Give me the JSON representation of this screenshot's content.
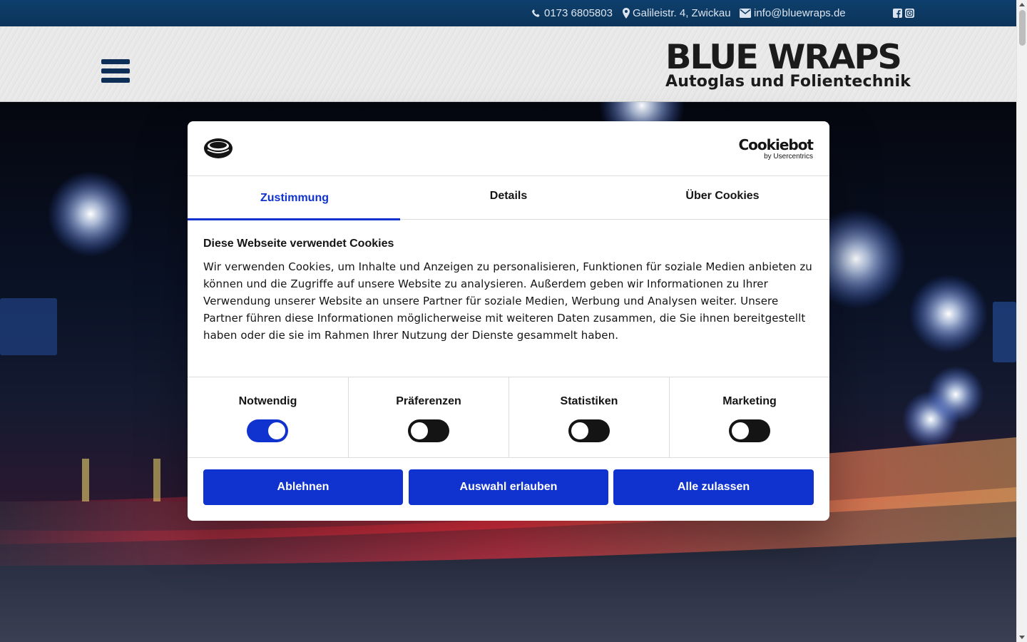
{
  "topbar": {
    "phone": "0173 6805803",
    "address": "Galileistr. 4, Zwickau",
    "email": "info@bluewraps.de",
    "icons": [
      "phone-icon",
      "map-marker-icon",
      "envelope-icon",
      "facebook-icon",
      "instagram-icon"
    ]
  },
  "header": {
    "menu_icon": "hamburger-menu-icon",
    "logo_line1": "BLUE WRAPS",
    "logo_line2": "Autoglas und Folientechnik"
  },
  "dialog": {
    "brand_name": "Cookiebot",
    "brand_sub": "by Usercentrics",
    "tabs": [
      {
        "label": "Zustimmung",
        "active": true
      },
      {
        "label": "Details",
        "active": false
      },
      {
        "label": "Über Cookies",
        "active": false
      }
    ],
    "heading": "Diese Webseite verwendet Cookies",
    "text": "Wir verwenden Cookies, um Inhalte und Anzeigen zu personalisieren, Funktionen für soziale Medien anbieten zu können und die Zugriffe auf unsere Website zu analysieren. Außerdem geben wir Informationen zu Ihrer Verwendung unserer Website an unsere Partner für soziale Medien, Werbung und Analysen weiter. Unsere Partner führen diese Informationen möglicherweise mit weiteren Daten zusammen, die Sie ihnen bereitgestellt haben oder die sie im Rahmen Ihrer Nutzung der Dienste gesammelt haben.",
    "categories": [
      {
        "label": "Notwendig",
        "enabled": true
      },
      {
        "label": "Präferenzen",
        "enabled": false
      },
      {
        "label": "Statistiken",
        "enabled": false
      },
      {
        "label": "Marketing",
        "enabled": false
      }
    ],
    "buttons": {
      "decline": "Ablehnen",
      "allow_selection": "Auswahl erlauben",
      "allow_all": "Alle zulassen"
    }
  },
  "colors": {
    "topbar": "#0e3f6c",
    "accent": "#1032cf",
    "menu_icon": "#0d2f57"
  }
}
